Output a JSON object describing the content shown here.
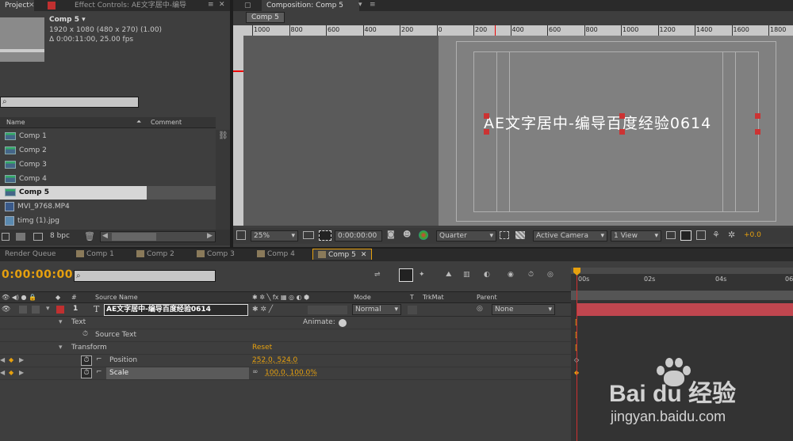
{
  "project_panel": {
    "tab_project": "Project",
    "tab_effect": "Effect Controls: AE文字居中-编导",
    "comp_name": "Comp 5 ▾",
    "comp_size": "1920 x 1080  (480 x 270) (1.00)",
    "comp_duration": "Δ 0:00:11:00, 25.00 fps",
    "search_placeholder": "",
    "col_name": "Name",
    "col_comment": "Comment",
    "items": [
      "Comp 1",
      "Comp 2",
      "Comp 3",
      "Comp 4",
      "Comp 5",
      "MVI_9768.MP4",
      "timg (1).jpg"
    ],
    "bpc": "8 bpc"
  },
  "composition": {
    "tab": "Composition: Comp 5",
    "subtab": "Comp 5",
    "ruler_labels": [
      "1000",
      "800",
      "600",
      "400",
      "200",
      "0",
      "200",
      "400",
      "600",
      "800",
      "1000",
      "1200",
      "1400",
      "1600",
      "1800"
    ],
    "canvas_text": "AE文字居中-编导百度经验0614",
    "zoom": "25%",
    "timecode": "0:00:00:00",
    "resolution": "Quarter",
    "camera": "Active Camera",
    "view": "1 View",
    "exposure": "+0.0"
  },
  "timeline": {
    "tabs": [
      "Render Queue",
      "Comp 1",
      "Comp 2",
      "Comp 3",
      "Comp 4",
      "Comp 5"
    ],
    "timecode": "0:00:00:00",
    "col_source": "Source Name",
    "col_mode": "Mode",
    "col_t": "T",
    "col_trkmat": "TrkMat",
    "col_parent": "Parent",
    "layer_number": "1",
    "layer_name": "AE文字居中-编导百度经验0614",
    "layer_mode": "Normal",
    "layer_parent": "None",
    "prop_text": "Text",
    "animate": "Animate:",
    "prop_source_text": "Source Text",
    "prop_transform": "Transform",
    "reset": "Reset",
    "prop_position": "Position",
    "position_value": "252.0, 524.0",
    "prop_scale": "Scale",
    "scale_value": "100.0, 100.0%",
    "time_labels": [
      "00s",
      "02s",
      "04s",
      "06"
    ]
  },
  "watermark": {
    "brand": "Bai du 经验",
    "url": "jingyan.baidu.com"
  },
  "colors": {
    "accent_orange": "#e6a00e",
    "layer_bar": "#c0464f",
    "label_red": "#c03030"
  }
}
